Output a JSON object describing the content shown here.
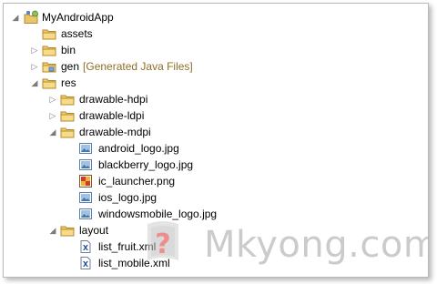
{
  "tree": {
    "project": {
      "label": "MyAndroidApp"
    },
    "assets": {
      "label": "assets"
    },
    "bin": {
      "label": "bin"
    },
    "gen": {
      "label": "gen",
      "decoration": "[Generated Java Files]"
    },
    "res": {
      "label": "res"
    },
    "drawable_hdpi": {
      "label": "drawable-hdpi"
    },
    "drawable_ldpi": {
      "label": "drawable-ldpi"
    },
    "drawable_mdpi": {
      "label": "drawable-mdpi"
    },
    "files_mdpi": [
      {
        "label": "android_logo.jpg"
      },
      {
        "label": "blackberry_logo.jpg"
      },
      {
        "label": "ic_launcher.png"
      },
      {
        "label": "ios_logo.jpg"
      },
      {
        "label": "windowsmobile_logo.jpg"
      }
    ],
    "layout": {
      "label": "layout"
    },
    "files_layout": [
      {
        "label": "list_fruit.xml"
      },
      {
        "label": "list_mobile.xml"
      }
    ]
  },
  "watermark": {
    "text": "Mkyong.com"
  },
  "icons": {
    "project": "android-project-icon",
    "folder": "folder-icon",
    "package_folder": "package-folder-icon",
    "image": "image-file-icon",
    "png": "png-file-icon",
    "xml": "xml-file-icon"
  },
  "colors": {
    "decoration": "#8d6f27",
    "border": "#b9b9b9"
  }
}
